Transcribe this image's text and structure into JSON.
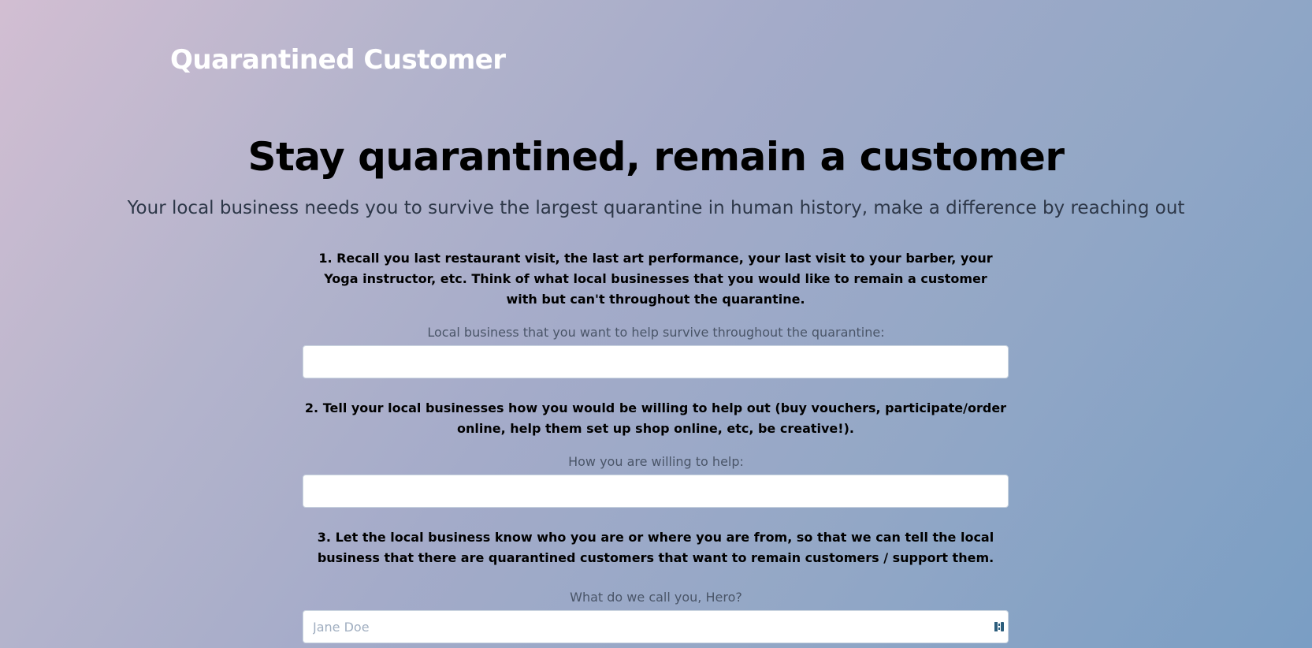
{
  "header": {
    "brand": "Quarantined Customer"
  },
  "hero": {
    "title": "Stay quarantined, remain a customer",
    "subtitle": "Your local business needs you to survive the largest quarantine in human history, make a difference by reaching out"
  },
  "form": {
    "step1": {
      "instruction": "1. Recall you last restaurant visit, the last art performance, your last visit to your barber, your Yoga instructor, etc. Think of what local businesses that you would like to remain a customer with but can't throughout the quarantine.",
      "label": "Local business that you want to help survive throughout the quarantine:",
      "value": "",
      "placeholder": ""
    },
    "step2": {
      "instruction": "2. Tell your local businesses how you would be willing to help out (buy vouchers, participate/order online, help them set up shop online, etc, be creative!).",
      "label": "How you are willing to help:",
      "value": "",
      "placeholder": ""
    },
    "step3": {
      "instruction": "3. Let the local business know who you are or where you are from, so that we can tell the local business that there are quarantined customers that want to remain customers / support them.",
      "label": "What do we call you, Hero?",
      "value": "",
      "placeholder": "Jane Doe",
      "autofill_icon": "password-manager-icon"
    }
  },
  "colors": {
    "gradient_start": "#d2bed2",
    "gradient_end": "#7a9ec4",
    "brand_text": "#ffffff",
    "subtitle_text": "#2d3748",
    "label_text": "#4a5568"
  }
}
